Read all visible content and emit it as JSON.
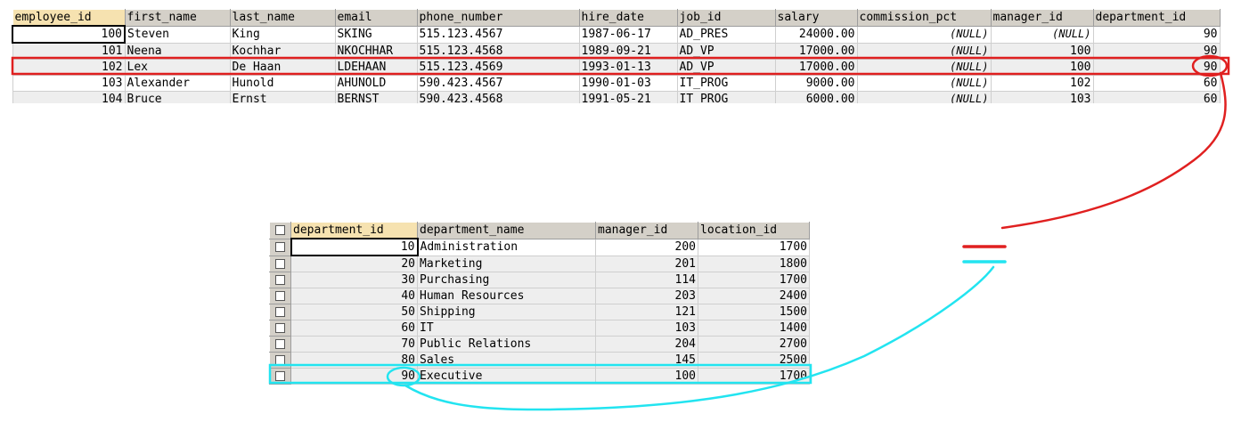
{
  "employees": {
    "columns": [
      "employee_id",
      "first_name",
      "last_name",
      "email",
      "phone_number",
      "hire_date",
      "job_id",
      "salary",
      "commission_pct",
      "manager_id",
      "department_id"
    ],
    "rows": [
      [
        "100",
        "Steven",
        "King",
        "SKING",
        "515.123.4567",
        "1987-06-17",
        "AD_PRES",
        "24000.00",
        "(NULL)",
        "(NULL)",
        "90"
      ],
      [
        "101",
        "Neena",
        "Kochhar",
        "NKOCHHAR",
        "515.123.4568",
        "1989-09-21",
        "AD_VP",
        "17000.00",
        "(NULL)",
        "100",
        "90"
      ],
      [
        "102",
        "Lex",
        "De Haan",
        "LDEHAAN",
        "515.123.4569",
        "1993-01-13",
        "AD_VP",
        "17000.00",
        "(NULL)",
        "100",
        "90"
      ],
      [
        "103",
        "Alexander",
        "Hunold",
        "AHUNOLD",
        "590.423.4567",
        "1990-01-03",
        "IT_PROG",
        "9000.00",
        "(NULL)",
        "102",
        "60"
      ],
      [
        "104",
        "Bruce",
        "Ernst",
        "BERNST",
        "590.423.4568",
        "1991-05-21",
        "IT_PROG",
        "6000.00",
        "(NULL)",
        "103",
        "60"
      ]
    ]
  },
  "departments": {
    "columns": [
      "department_id",
      "department_name",
      "manager_id",
      "location_id"
    ],
    "rows": [
      [
        "10",
        "Administration",
        "200",
        "1700"
      ],
      [
        "20",
        "Marketing",
        "201",
        "1800"
      ],
      [
        "30",
        "Purchasing",
        "114",
        "1700"
      ],
      [
        "40",
        "Human Resources",
        "203",
        "2400"
      ],
      [
        "50",
        "Shipping",
        "121",
        "1500"
      ],
      [
        "60",
        "IT",
        "103",
        "1400"
      ],
      [
        "70",
        "Public Relations",
        "204",
        "2700"
      ],
      [
        "80",
        "Sales",
        "145",
        "2500"
      ],
      [
        "90",
        "Executive",
        "100",
        "1700"
      ]
    ]
  },
  "annotation_colors": {
    "employee_highlight": "#e02020",
    "department_highlight": "#22e4f0"
  }
}
